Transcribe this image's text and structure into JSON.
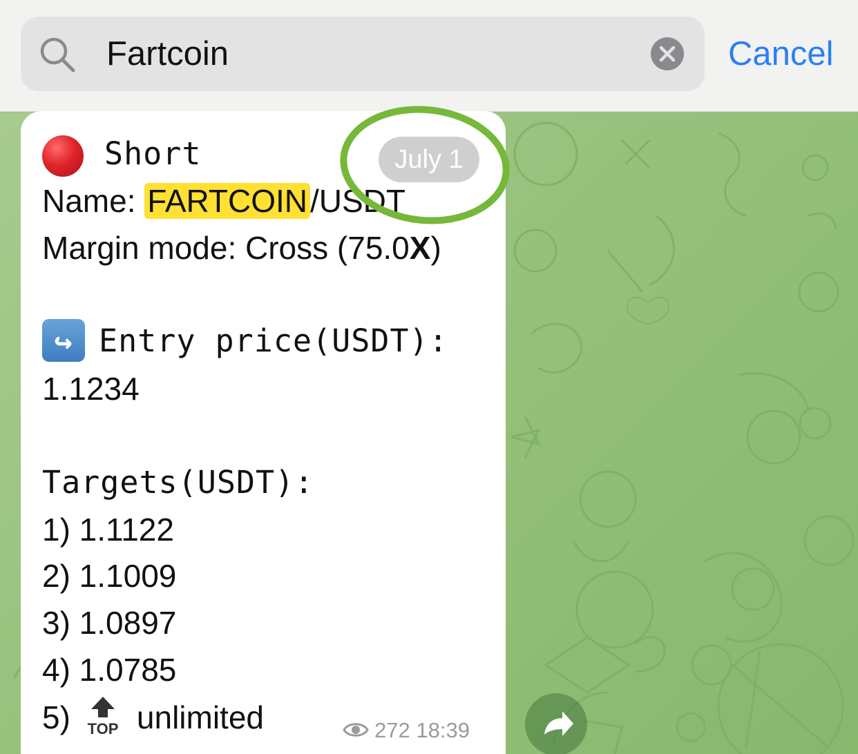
{
  "search": {
    "query": "Fartcoin",
    "cancel_label": "Cancel"
  },
  "message": {
    "header": "Short",
    "name_label": "Name: ",
    "name_highlight": "FARTCOIN",
    "name_rest": "/USDT",
    "margin_prefix": "Margin mode: Cross (75.0",
    "margin_x": "X",
    "margin_suffix": ")",
    "entry_label": "Entry price(USDT):",
    "entry_value": "1.1234",
    "targets_label": "Targets(USDT):",
    "targets": [
      "1) 1.1122",
      "2) 1.1009",
      "3) 1.0897",
      "4) 1.0785"
    ],
    "target5_prefix": "5)",
    "target5_icon_text": "TOP",
    "target5_suffix": "unlimited",
    "date": "July 1",
    "views": "272",
    "time": "18:39"
  },
  "colors": {
    "accent": "#2b7ff5",
    "highlight": "#ffe033",
    "annotation_circle": "#76b83a",
    "chat_background": "#9cc385"
  }
}
